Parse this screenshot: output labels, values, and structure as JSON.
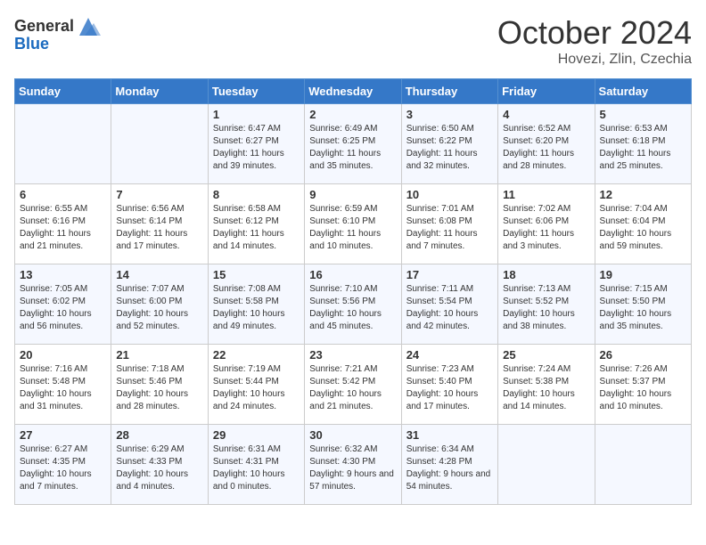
{
  "header": {
    "logo_general": "General",
    "logo_blue": "Blue",
    "month_title": "October 2024",
    "location": "Hovezi, Zlin, Czechia"
  },
  "days_of_week": [
    "Sunday",
    "Monday",
    "Tuesday",
    "Wednesday",
    "Thursday",
    "Friday",
    "Saturday"
  ],
  "weeks": [
    [
      {
        "day": "",
        "info": ""
      },
      {
        "day": "",
        "info": ""
      },
      {
        "day": "1",
        "info": "Sunrise: 6:47 AM\nSunset: 6:27 PM\nDaylight: 11 hours and 39 minutes."
      },
      {
        "day": "2",
        "info": "Sunrise: 6:49 AM\nSunset: 6:25 PM\nDaylight: 11 hours and 35 minutes."
      },
      {
        "day": "3",
        "info": "Sunrise: 6:50 AM\nSunset: 6:22 PM\nDaylight: 11 hours and 32 minutes."
      },
      {
        "day": "4",
        "info": "Sunrise: 6:52 AM\nSunset: 6:20 PM\nDaylight: 11 hours and 28 minutes."
      },
      {
        "day": "5",
        "info": "Sunrise: 6:53 AM\nSunset: 6:18 PM\nDaylight: 11 hours and 25 minutes."
      }
    ],
    [
      {
        "day": "6",
        "info": "Sunrise: 6:55 AM\nSunset: 6:16 PM\nDaylight: 11 hours and 21 minutes."
      },
      {
        "day": "7",
        "info": "Sunrise: 6:56 AM\nSunset: 6:14 PM\nDaylight: 11 hours and 17 minutes."
      },
      {
        "day": "8",
        "info": "Sunrise: 6:58 AM\nSunset: 6:12 PM\nDaylight: 11 hours and 14 minutes."
      },
      {
        "day": "9",
        "info": "Sunrise: 6:59 AM\nSunset: 6:10 PM\nDaylight: 11 hours and 10 minutes."
      },
      {
        "day": "10",
        "info": "Sunrise: 7:01 AM\nSunset: 6:08 PM\nDaylight: 11 hours and 7 minutes."
      },
      {
        "day": "11",
        "info": "Sunrise: 7:02 AM\nSunset: 6:06 PM\nDaylight: 11 hours and 3 minutes."
      },
      {
        "day": "12",
        "info": "Sunrise: 7:04 AM\nSunset: 6:04 PM\nDaylight: 10 hours and 59 minutes."
      }
    ],
    [
      {
        "day": "13",
        "info": "Sunrise: 7:05 AM\nSunset: 6:02 PM\nDaylight: 10 hours and 56 minutes."
      },
      {
        "day": "14",
        "info": "Sunrise: 7:07 AM\nSunset: 6:00 PM\nDaylight: 10 hours and 52 minutes."
      },
      {
        "day": "15",
        "info": "Sunrise: 7:08 AM\nSunset: 5:58 PM\nDaylight: 10 hours and 49 minutes."
      },
      {
        "day": "16",
        "info": "Sunrise: 7:10 AM\nSunset: 5:56 PM\nDaylight: 10 hours and 45 minutes."
      },
      {
        "day": "17",
        "info": "Sunrise: 7:11 AM\nSunset: 5:54 PM\nDaylight: 10 hours and 42 minutes."
      },
      {
        "day": "18",
        "info": "Sunrise: 7:13 AM\nSunset: 5:52 PM\nDaylight: 10 hours and 38 minutes."
      },
      {
        "day": "19",
        "info": "Sunrise: 7:15 AM\nSunset: 5:50 PM\nDaylight: 10 hours and 35 minutes."
      }
    ],
    [
      {
        "day": "20",
        "info": "Sunrise: 7:16 AM\nSunset: 5:48 PM\nDaylight: 10 hours and 31 minutes."
      },
      {
        "day": "21",
        "info": "Sunrise: 7:18 AM\nSunset: 5:46 PM\nDaylight: 10 hours and 28 minutes."
      },
      {
        "day": "22",
        "info": "Sunrise: 7:19 AM\nSunset: 5:44 PM\nDaylight: 10 hours and 24 minutes."
      },
      {
        "day": "23",
        "info": "Sunrise: 7:21 AM\nSunset: 5:42 PM\nDaylight: 10 hours and 21 minutes."
      },
      {
        "day": "24",
        "info": "Sunrise: 7:23 AM\nSunset: 5:40 PM\nDaylight: 10 hours and 17 minutes."
      },
      {
        "day": "25",
        "info": "Sunrise: 7:24 AM\nSunset: 5:38 PM\nDaylight: 10 hours and 14 minutes."
      },
      {
        "day": "26",
        "info": "Sunrise: 7:26 AM\nSunset: 5:37 PM\nDaylight: 10 hours and 10 minutes."
      }
    ],
    [
      {
        "day": "27",
        "info": "Sunrise: 6:27 AM\nSunset: 4:35 PM\nDaylight: 10 hours and 7 minutes."
      },
      {
        "day": "28",
        "info": "Sunrise: 6:29 AM\nSunset: 4:33 PM\nDaylight: 10 hours and 4 minutes."
      },
      {
        "day": "29",
        "info": "Sunrise: 6:31 AM\nSunset: 4:31 PM\nDaylight: 10 hours and 0 minutes."
      },
      {
        "day": "30",
        "info": "Sunrise: 6:32 AM\nSunset: 4:30 PM\nDaylight: 9 hours and 57 minutes."
      },
      {
        "day": "31",
        "info": "Sunrise: 6:34 AM\nSunset: 4:28 PM\nDaylight: 9 hours and 54 minutes."
      },
      {
        "day": "",
        "info": ""
      },
      {
        "day": "",
        "info": ""
      }
    ]
  ]
}
